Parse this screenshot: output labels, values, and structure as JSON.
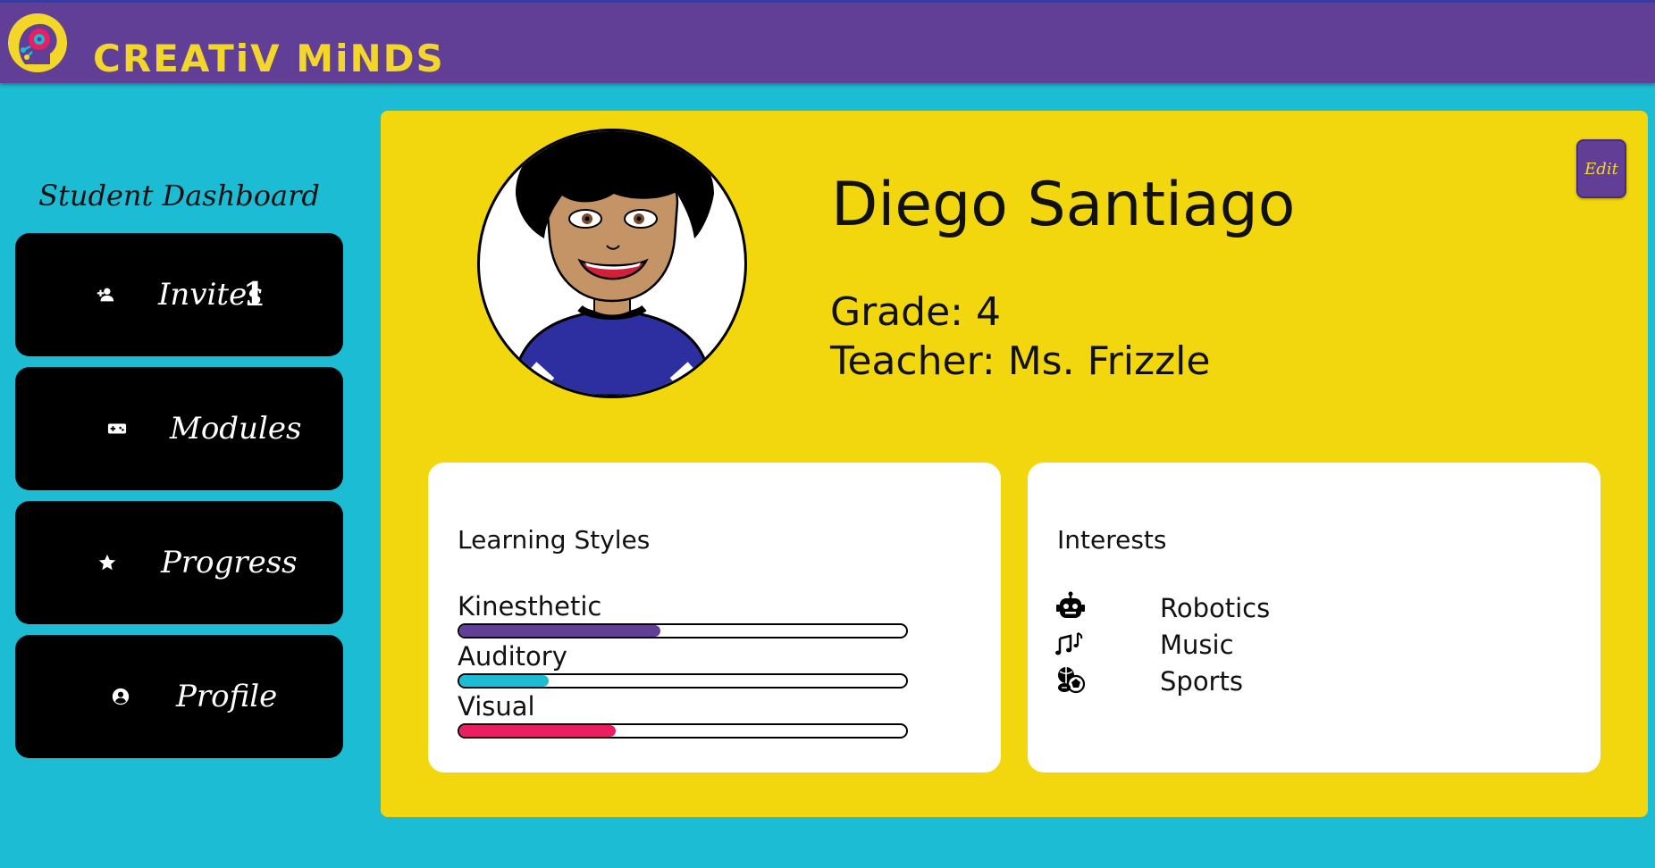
{
  "header": {
    "brand": "CREATiV MiNDS",
    "colors": {
      "bar": "#623f97",
      "brand_text": "#f3d62a"
    }
  },
  "sidebar": {
    "title": "Student Dashboard",
    "items": [
      {
        "label": "Invites",
        "icon": "person-add-icon",
        "badge": "1"
      },
      {
        "label": "Modules",
        "icon": "gamepad-icon"
      },
      {
        "label": "Progress",
        "icon": "star-icon"
      },
      {
        "label": "Profile",
        "icon": "account-circle-icon"
      }
    ]
  },
  "profile": {
    "name": "Diego Santiago",
    "grade": "Grade: 4",
    "teacher": "Teacher: Ms. Frizzle",
    "edit_label": "Edit",
    "avatar_icon": "student-avatar"
  },
  "learning_styles": {
    "title": "Learning Styles",
    "items": [
      {
        "label": "Kinesthetic",
        "level": 0.45,
        "color": "#623f97"
      },
      {
        "label": "Auditory",
        "level": 0.2,
        "color": "#1bbcd4"
      },
      {
        "label": "Visual",
        "level": 0.35,
        "color": "#e91e63"
      }
    ]
  },
  "interests": {
    "title": "Interests",
    "items": [
      {
        "label": "Robotics",
        "icon": "robot-icon"
      },
      {
        "label": "Music",
        "icon": "music-notes-icon"
      },
      {
        "label": "Sports",
        "icon": "sports-balls-icon"
      }
    ]
  },
  "colors": {
    "page_bg": "#1bbcd4",
    "panel_bg": "#f2d70e",
    "nav_bg": "#000000",
    "card_bg": "#ffffff"
  }
}
